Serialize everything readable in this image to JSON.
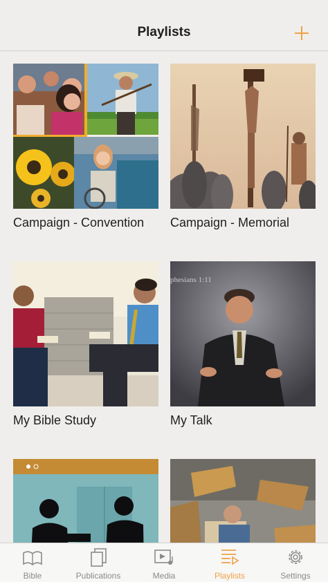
{
  "header": {
    "title": "Playlists",
    "add_icon": "plus-icon"
  },
  "playlists": [
    {
      "title": "Campaign - Convention",
      "image": "convention-collage"
    },
    {
      "title": "Campaign - Memorial",
      "image": "crucifixion-scene"
    },
    {
      "title": "My Bible Study",
      "image": "two-men-bible-study"
    },
    {
      "title": "My Talk",
      "image": "man-giving-talk"
    },
    {
      "title": "",
      "image": "silhouette-doorstep"
    },
    {
      "title": "",
      "image": "man-with-scrolls"
    }
  ],
  "image_text": {
    "talk_scripture": "phesians 1:11"
  },
  "tabs": [
    {
      "label": "Bible",
      "icon": "book-icon",
      "active": false
    },
    {
      "label": "Publications",
      "icon": "publications-icon",
      "active": false
    },
    {
      "label": "Media",
      "icon": "media-icon",
      "active": false
    },
    {
      "label": "Playlists",
      "icon": "playlist-icon",
      "active": true
    },
    {
      "label": "Settings",
      "icon": "gear-icon",
      "active": false
    }
  ],
  "colors": {
    "accent": "#f0a046",
    "inactive": "#8a8a8a",
    "background": "#efeeec"
  }
}
